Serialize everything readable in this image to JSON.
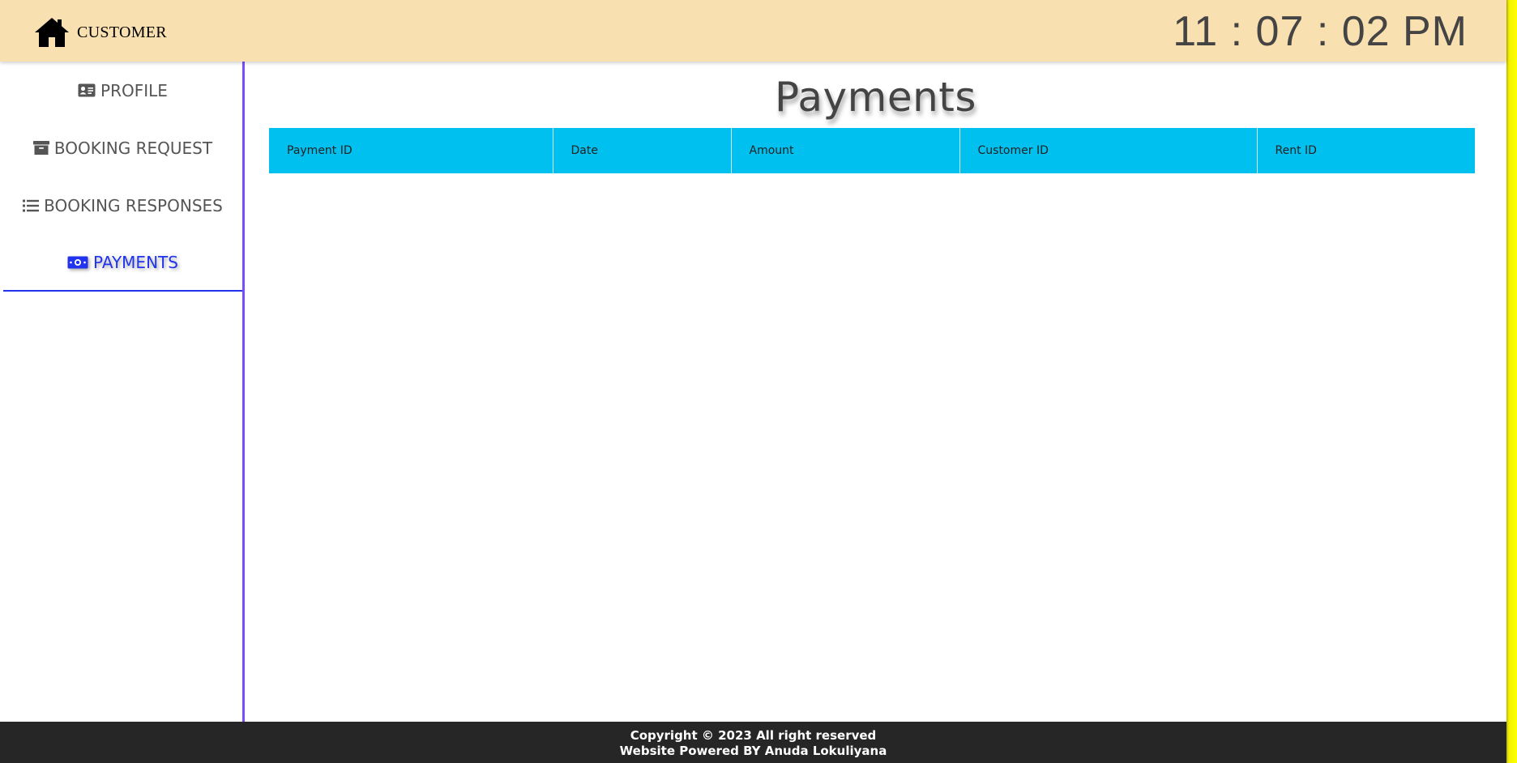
{
  "header": {
    "brand": "CUSTOMER",
    "clock": "11 : 07 : 02 PM",
    "background_color": "#f9e0b0"
  },
  "sidebar": {
    "items": [
      {
        "label": "PROFILE",
        "icon": "id-card-icon"
      },
      {
        "label": "BOOKING REQUEST",
        "icon": "archive-box-icon"
      },
      {
        "label": "BOOKING RESPONSES",
        "icon": "list-icon"
      },
      {
        "label": "PAYMENTS",
        "icon": "money-bill-icon",
        "active": true
      }
    ],
    "active_color": "#2233ee",
    "border_color": "#7b4dff"
  },
  "main": {
    "title": "Payments",
    "table": {
      "columns": [
        "Payment ID",
        "Date",
        "Amount",
        "Customer ID",
        "Rent ID"
      ],
      "rows": [],
      "header_color": "#00c0ef"
    }
  },
  "footer": {
    "line1": "Copyright © 2023 All right reserved",
    "line2": "Website Powered BY Anuda Lokuliyana"
  }
}
